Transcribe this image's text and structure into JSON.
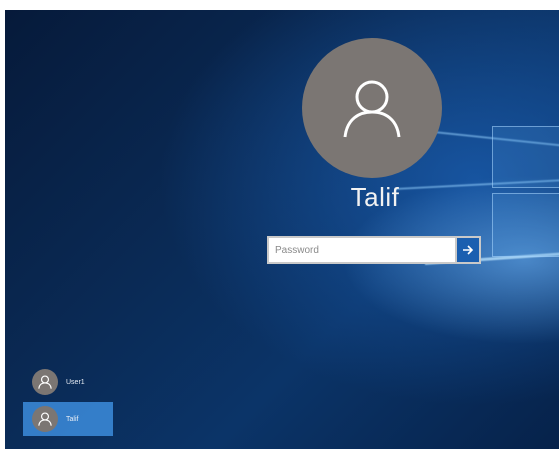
{
  "login": {
    "username": "Talif",
    "password_placeholder": "Password"
  },
  "user_list": [
    {
      "label": "User1",
      "selected": false
    },
    {
      "label": "Talif",
      "selected": true
    }
  ],
  "icons": {
    "avatar": "person-icon",
    "submit": "arrow-right-icon"
  },
  "colors": {
    "avatar_bg": "#7b7673",
    "submit_bg": "#1b5fb0",
    "selected_user_bg": "#3c8cdc"
  }
}
